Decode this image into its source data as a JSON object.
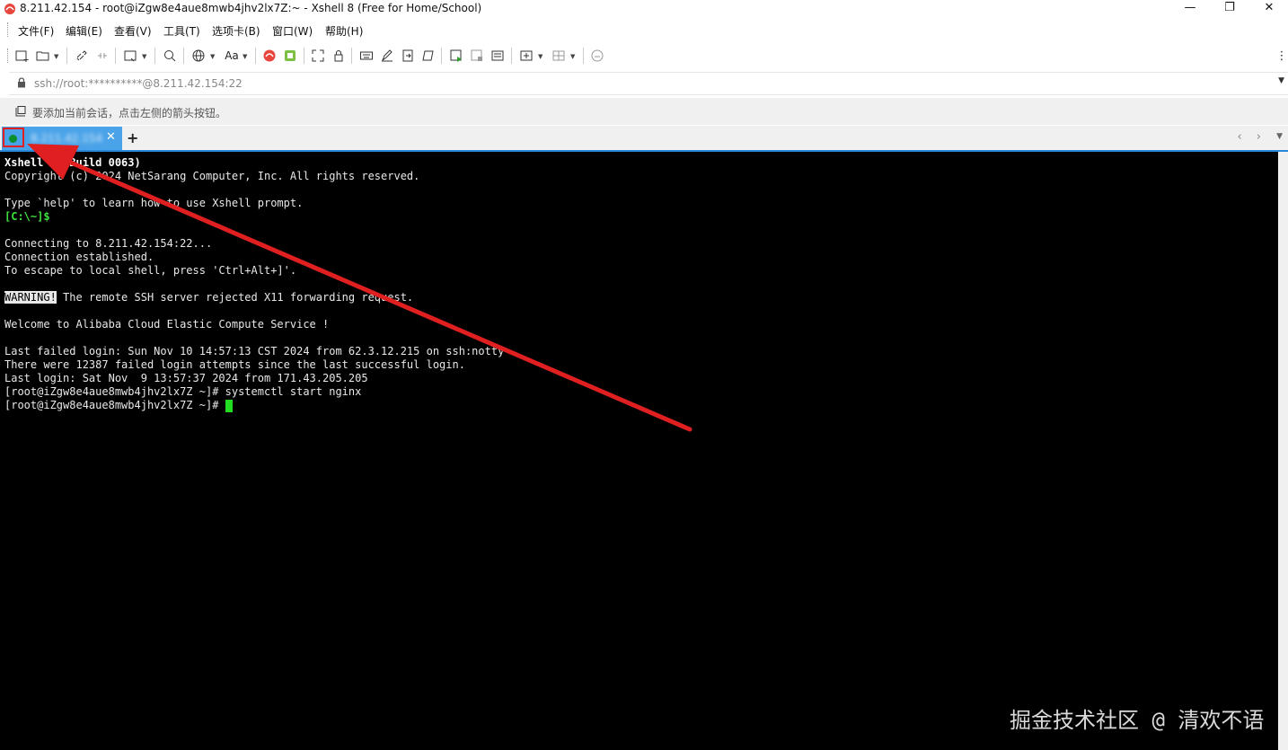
{
  "window": {
    "title": "8.211.42.154 - root@iZgw8e4aue8mwb4jhv2lx7Z:~ - Xshell 8 (Free for Home/School)",
    "minimize": "—",
    "maximize": "❐",
    "close": "✕"
  },
  "menu": [
    "文件(F)",
    "编辑(E)",
    "查看(V)",
    "工具(T)",
    "选项卡(B)",
    "窗口(W)",
    "帮助(H)"
  ],
  "address": {
    "value": "ssh://root:**********@8.211.42.154:22",
    "dropdown_icon": "chevron-down-icon"
  },
  "hint": {
    "text": "要添加当前会话，点击左侧的箭头按钮。"
  },
  "tabs": [
    {
      "label": "8.211.42.154",
      "status_color": "#0b8f2f",
      "close": "✕"
    }
  ],
  "new_tab": "+",
  "nav_arrows": "‹ ›",
  "tab_menu": "▼",
  "terminal": {
    "lines": [
      "Xshell 8 (Build 0063)",
      "Copyright (c) 2024 NetSarang Computer, Inc. All rights reserved.",
      "",
      "Type `help' to learn how to use Xshell prompt.",
      "[C:\\~]$",
      "",
      "Connecting to 8.211.42.154:22...",
      "Connection established.",
      "To escape to local shell, press 'Ctrl+Alt+]'.",
      "",
      "WARNING!",
      " The remote SSH server rejected X11 forwarding request.",
      "",
      "Welcome to Alibaba Cloud Elastic Compute Service !",
      "",
      "Last failed login: Sun Nov 10 14:57:13 CST 2024 from 62.3.12.215 on ssh:notty",
      "There were 12387 failed login attempts since the last successful login.",
      "Last login: Sat Nov  9 13:57:37 2024 from 171.43.205.205",
      "[root@iZgw8e4aue8mwb4jhv2lx7Z ~]# systemctl start nginx",
      "[root@iZgw8e4aue8mwb4jhv2lx7Z ~]# "
    ]
  },
  "watermark": "掘金技术社区 @ 清欢不语",
  "colors": {
    "accent": "#2b88d8",
    "tab": "#4aa3e8",
    "annotation": "#e02020",
    "prompt_green": "#3ee03e"
  }
}
